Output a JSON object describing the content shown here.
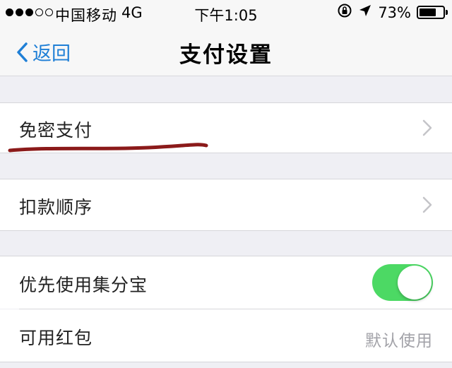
{
  "status_bar": {
    "carrier": "中国移动",
    "network": "4G",
    "time": "下午1:05",
    "battery": "73%",
    "battery_level": 0.73,
    "signal_bars_filled": 3,
    "signal_bars_total": 5
  },
  "nav": {
    "back_label": "返回",
    "title": "支付设置"
  },
  "settings": {
    "password_free_payment": "免密支付",
    "deduction_order": "扣款顺序",
    "priority_jifenbao": "优先使用集分宝",
    "priority_jifenbao_enabled": true,
    "red_packet_label": "可用红包",
    "red_packet_value": "默认使用"
  },
  "colors": {
    "accent": "#1f7fd6",
    "toggle_on": "#4cd964",
    "underline_mark": "#8b1a1a"
  }
}
